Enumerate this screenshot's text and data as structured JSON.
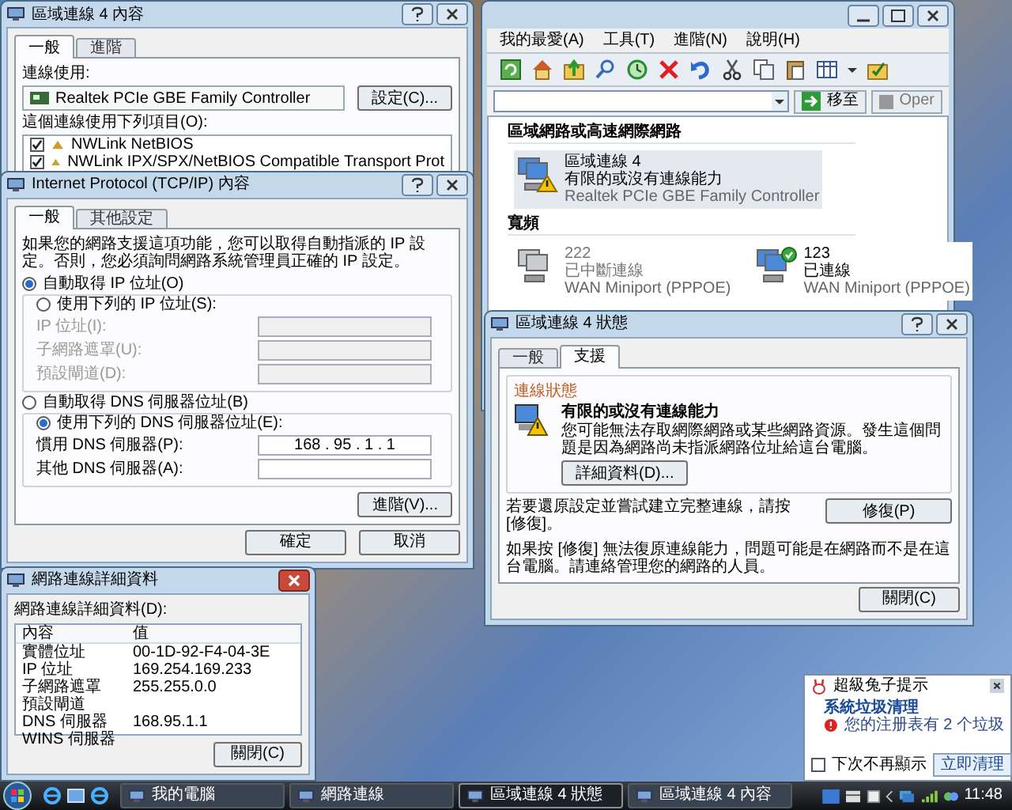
{
  "props_window": {
    "title": "區域連線 4 內容",
    "tabs": [
      {
        "label": "一般",
        "selected": true
      },
      {
        "label": "進階",
        "selected": false
      }
    ],
    "connect_using_label": "連線使用:",
    "adapter": "Realtek PCIe GBE Family Controller",
    "configure_button": "設定(C)...",
    "items_label": "這個連線使用下列項目(O):",
    "items": [
      {
        "label": "NWLink NetBIOS",
        "checked": true
      },
      {
        "label": "NWLink IPX/SPX/NetBIOS Compatible Transport Prot",
        "checked": true
      }
    ]
  },
  "tcpip_window": {
    "title": "Internet Protocol (TCP/IP) 內容",
    "tabs": [
      {
        "label": "一般",
        "selected": true
      },
      {
        "label": "其他設定",
        "selected": false
      }
    ],
    "intro": "如果您的網路支援這項功能，您可以取得自動指派的 IP 設定。否則，您必須詢問網路系統管理員正確的 IP 設定。",
    "ip_options": [
      {
        "label": "自動取得 IP 位址(O)",
        "selected": true
      },
      {
        "label": "使用下列的 IP 位址(S):",
        "selected": false
      }
    ],
    "ip_fields": [
      {
        "label": "IP 位址(I):",
        "disabled": true
      },
      {
        "label": "子網路遮罩(U):",
        "disabled": true
      },
      {
        "label": "預設閘道(D):",
        "disabled": true
      }
    ],
    "dns_options": [
      {
        "label": "自動取得 DNS 伺服器位址(B)",
        "selected": false
      },
      {
        "label": "使用下列的 DNS 伺服器位址(E):",
        "selected": true
      }
    ],
    "dns_fields": [
      {
        "label": "慣用 DNS 伺服器(P):",
        "value": "168 . 95 . 1 . 1",
        "disabled": false
      },
      {
        "label": "其他 DNS 伺服器(A):",
        "disabled": false
      }
    ],
    "advanced_button": "進階(V)...",
    "buttons": [
      "確定",
      "取消"
    ]
  },
  "status_window": {
    "title": "區域連線 4 狀態",
    "tabs": [
      {
        "label": "一般",
        "selected": false
      },
      {
        "label": "支援",
        "selected": true
      }
    ],
    "group_label": "連線狀態",
    "status_heading": "有限的或沒有連線能力",
    "status_text": "您可能無法存取網際網路或某些網路資源。發生這個問題是因為網路尚未指派網路位址給這台電腦。",
    "details_button": "詳細資料(D)...",
    "repair_text": "若要還原設定並嘗試建立完整連線，請按 [修復]。",
    "repair_button": "修復(P)",
    "help_text": "如果按 [修復] 無法復原連線能力，問題可能是在網路而不是在這台電腦。請連絡管理您的網路的人員。",
    "close_button": "關閉(C)"
  },
  "explorer": {
    "menu": [
      "我的最愛(A)",
      "工具(T)",
      "進階(N)",
      "說明(H)"
    ],
    "go_button": "移至",
    "cut_button": "Oper",
    "groups": [
      {
        "heading": "區域網路或高速網際網路",
        "items": [
          {
            "name": "區域連線 4",
            "status": "有限的或沒有連線能力",
            "device": "Realtek PCIe GBE Family Controller",
            "kind": "warning",
            "selected": true
          }
        ]
      },
      {
        "heading": "寬頻",
        "items": [
          {
            "name": "222",
            "status": "已中斷連線",
            "device": "WAN Miniport (PPPOE)",
            "kind": "disconnected",
            "selected": false
          },
          {
            "name": "123",
            "status": "已連線",
            "device": "WAN Miniport (PPPOE)",
            "kind": "connected",
            "selected": false
          }
        ]
      }
    ]
  },
  "details_window": {
    "title": "網路連線詳細資料",
    "label": "網路連線詳細資料(D):",
    "columns": [
      "內容",
      "值"
    ],
    "rows": [
      {
        "property": "實體位址",
        "value": "00-1D-92-F4-04-3E"
      },
      {
        "property": "IP 位址",
        "value": "169.254.169.233"
      },
      {
        "property": "子網路遮罩",
        "value": "255.255.0.0"
      },
      {
        "property": "預設閘道"
      },
      {
        "property": "DNS 伺服器",
        "value": "168.95.1.1"
      },
      {
        "property": "WINS 伺服器"
      }
    ],
    "close_button": "關閉(C)"
  },
  "notification": {
    "title": "超級兔子提示",
    "heading": "系統垃圾清理",
    "message": "您的注册表有 2 个垃圾",
    "action_button": "立即清理",
    "dont_show": {
      "label": "下次不再顯示",
      "checked": false
    }
  },
  "taskbar": {
    "buttons": [
      {
        "label": "我的電腦",
        "selected": false
      },
      {
        "label": "網路連線",
        "selected": false
      },
      {
        "label": "區域連線 4 狀態",
        "selected": true
      },
      {
        "label": "區域連線 4 內容",
        "selected": false
      }
    ],
    "clock": "11:48"
  }
}
